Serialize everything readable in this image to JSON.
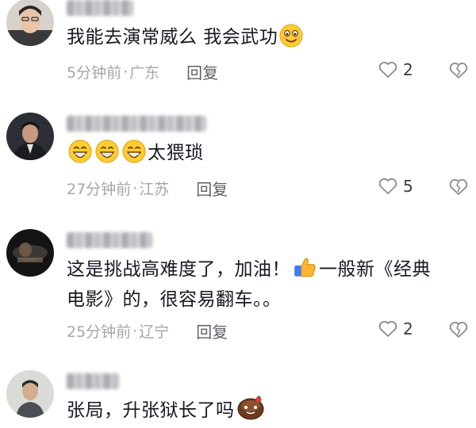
{
  "comments": [
    {
      "text_before": "我能去演常威么 我会武功",
      "time": "5分钟前",
      "location": "广东",
      "reply_label": "回复",
      "likes": "2"
    },
    {
      "text_after": "太猥琐",
      "time": "27分钟前",
      "location": "江苏",
      "reply_label": "回复",
      "likes": "5"
    },
    {
      "line1_before": "这是挑战高难度了，加油！",
      "line1_after": "一般新《经典",
      "line2": "电影》的，很容易翻车。。",
      "time": "25分钟前",
      "location": "辽宁",
      "reply_label": "回复",
      "likes": "2"
    },
    {
      "text_before": "张局，升张狱长了吗"
    }
  ],
  "separator": "·",
  "icons": {
    "like": "heart-outline-icon",
    "dislike": "broken-heart-icon"
  },
  "colors": {
    "text": "#161823",
    "meta": "#a5a6ab",
    "reply": "#5f6067"
  }
}
